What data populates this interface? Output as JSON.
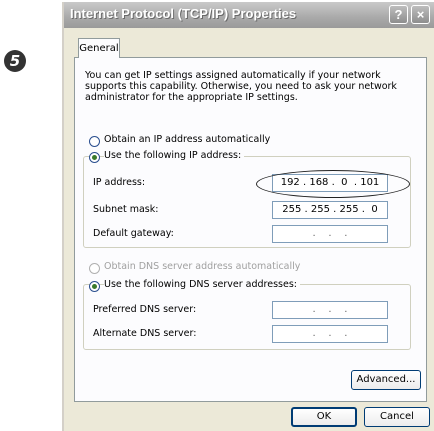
{
  "step_number": "5",
  "window": {
    "title": "Internet Protocol (TCP/IP) Properties",
    "help_button": "?",
    "close_button": "×"
  },
  "tabs": [
    "General"
  ],
  "intro_text": "You can get IP settings assigned automatically if your network supports this capability. Otherwise, you need to ask your network administrator for the appropriate IP settings.",
  "ip_section": {
    "option_auto": "Obtain an IP address automatically",
    "option_manual": "Use the following IP address:",
    "selected": "manual",
    "fields": [
      {
        "label": "IP address:",
        "value": "192 . 168 .  0  . 101"
      },
      {
        "label": "Subnet mask:",
        "value": "255 . 255 . 255 .  0"
      },
      {
        "label": "Default gateway:",
        "value": " .    .    . "
      }
    ]
  },
  "dns_section": {
    "option_auto": "Obtain DNS server address automatically",
    "option_manual": "Use the following DNS server addresses:",
    "selected": "manual",
    "fields": [
      {
        "label": "Preferred DNS server:",
        "value": " .    .    . "
      },
      {
        "label": "Alternate DNS server:",
        "value": " .    .    . "
      }
    ]
  },
  "buttons": {
    "advanced": "Advanced...",
    "ok": "OK",
    "cancel": "Cancel"
  }
}
